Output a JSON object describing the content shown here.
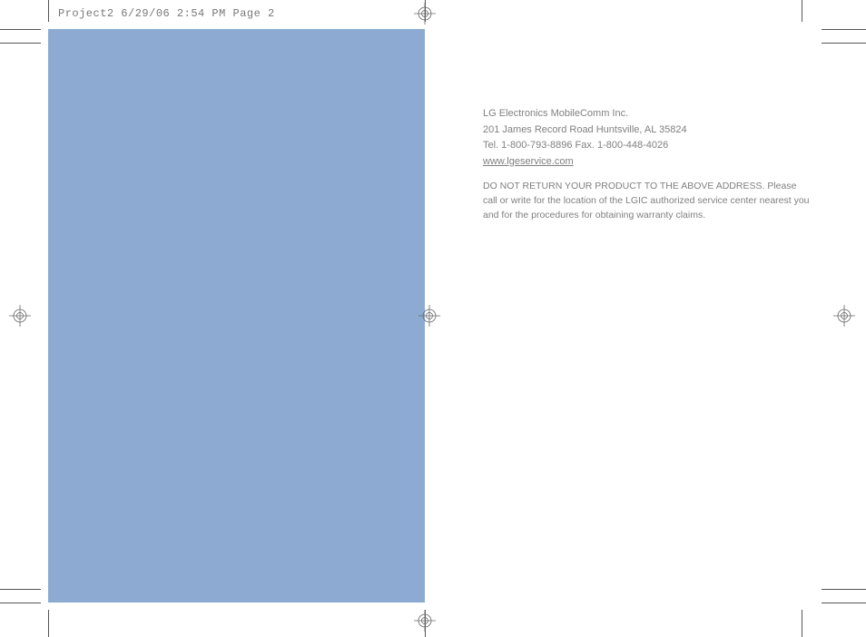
{
  "header": {
    "label": "Project2  6/29/06  2:54 PM  Page 2"
  },
  "contact": {
    "company": "LG Electronics MobileComm Inc.",
    "address": "201 James Record Road Huntsville, AL 35824",
    "phone": "Tel. 1-800-793-8896 Fax. 1-800-448-4026",
    "website": "www.lgeservice.com"
  },
  "notice": "DO NOT RETURN YOUR PRODUCT TO THE ABOVE ADDRESS. Please call or write for the location of the LGIC authorized service center nearest you and for the procedures for obtaining warranty claims."
}
